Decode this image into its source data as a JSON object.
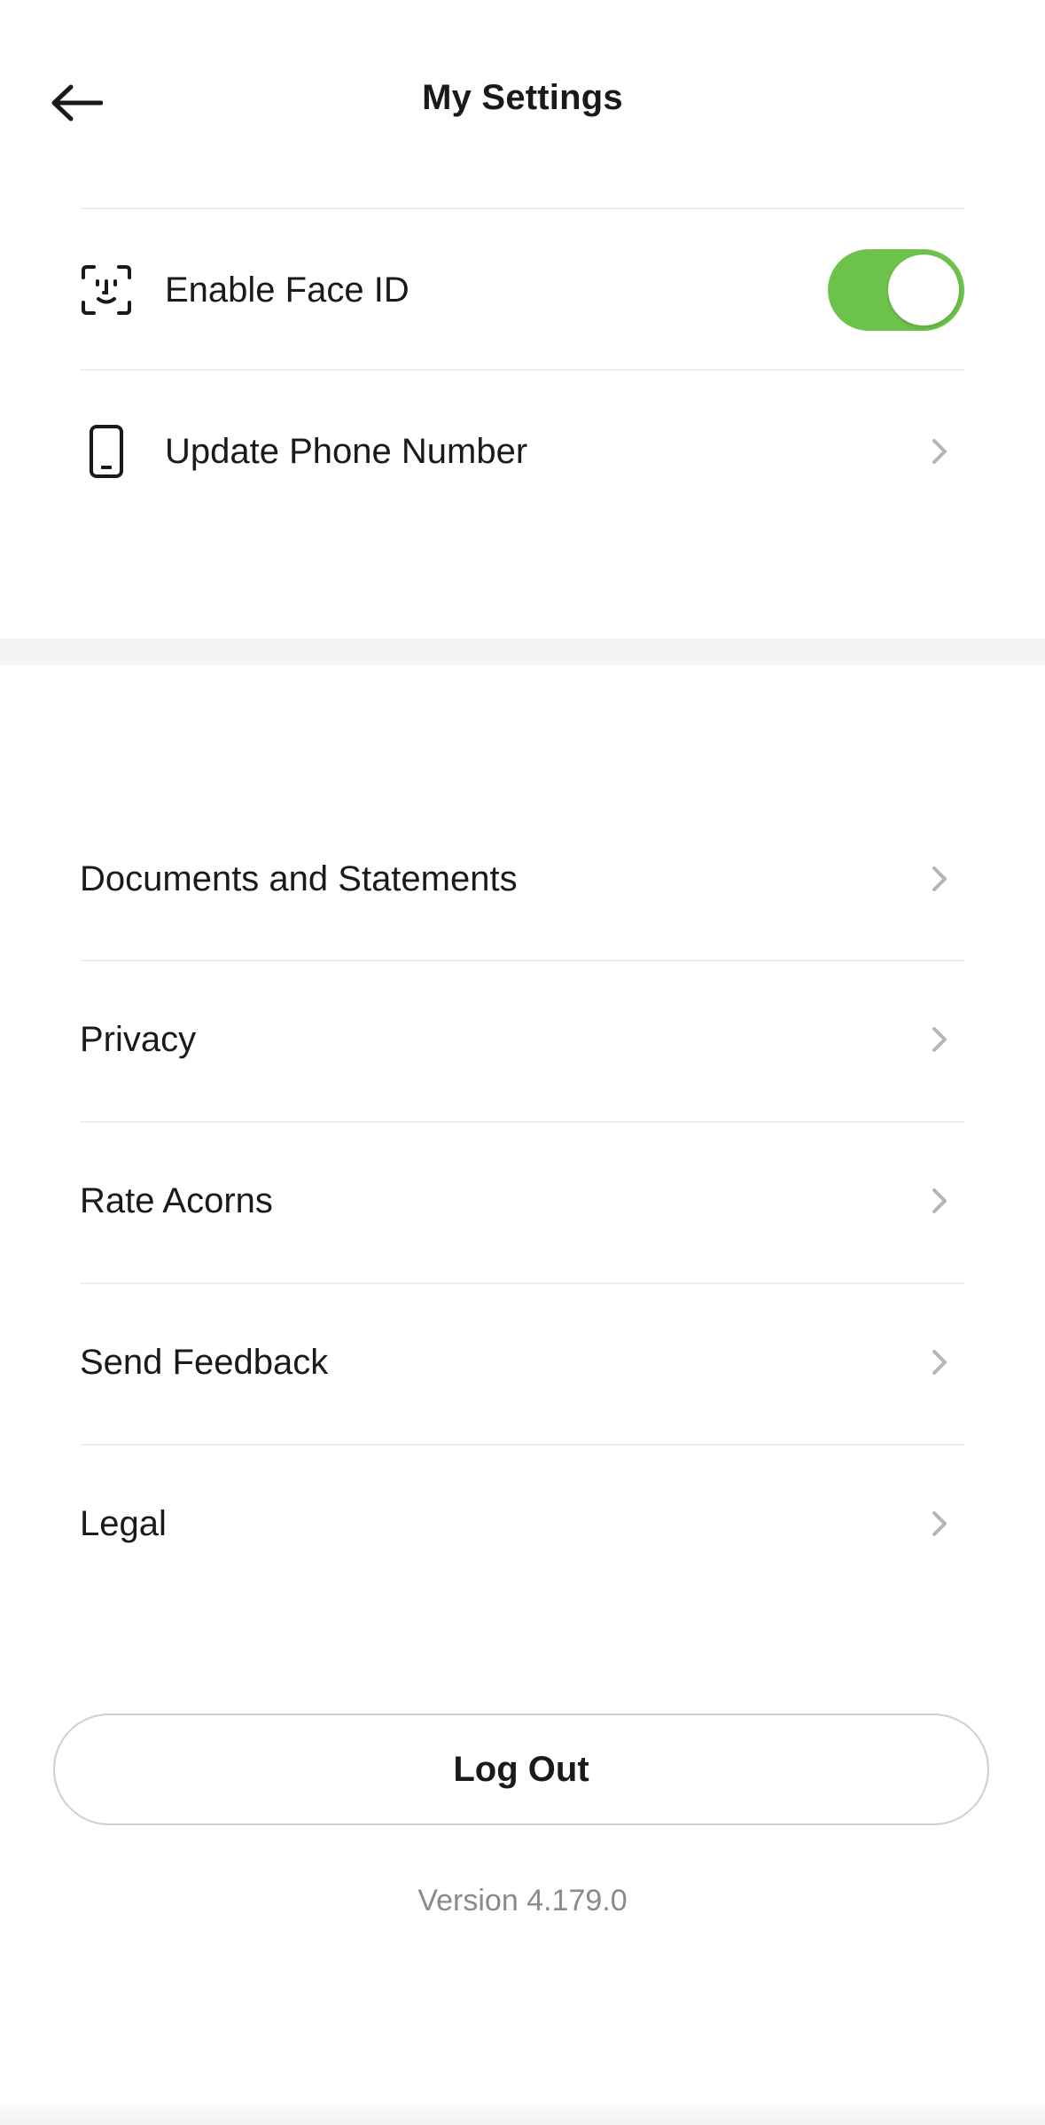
{
  "header": {
    "title": "My Settings",
    "back_icon": "arrow-left-icon"
  },
  "security": {
    "face_id": {
      "label": "Enable Face ID",
      "icon": "face-id-icon",
      "enabled": true,
      "toggle_color": "#6cc24a"
    },
    "phone": {
      "label": "Update Phone Number",
      "icon": "phone-icon"
    }
  },
  "menu": {
    "items": [
      {
        "label": "Documents and Statements"
      },
      {
        "label": "Privacy"
      },
      {
        "label": "Rate Acorns"
      },
      {
        "label": "Send Feedback"
      },
      {
        "label": "Legal"
      }
    ]
  },
  "footer": {
    "logout_label": "Log Out",
    "version": "Version 4.179.0"
  }
}
